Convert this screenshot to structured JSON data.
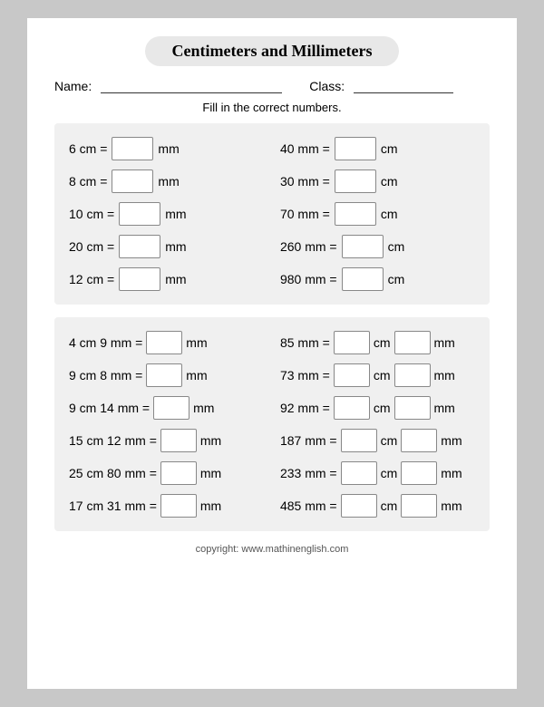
{
  "title": "Centimeters and Millimeters",
  "fields": {
    "name_label": "Name:",
    "class_label": "Class:"
  },
  "instruction": "Fill in the correct numbers.",
  "section1": {
    "left": [
      {
        "problem": "6 cm =",
        "unit": "mm"
      },
      {
        "problem": "8 cm =",
        "unit": "mm"
      },
      {
        "problem": "10 cm =",
        "unit": "mm"
      },
      {
        "problem": "20 cm =",
        "unit": "mm"
      },
      {
        "problem": "12 cm =",
        "unit": "mm"
      }
    ],
    "right": [
      {
        "problem": "40 mm =",
        "unit": "cm"
      },
      {
        "problem": "30 mm =",
        "unit": "cm"
      },
      {
        "problem": "70 mm =",
        "unit": "cm"
      },
      {
        "problem": "260 mm  =",
        "unit": "cm"
      },
      {
        "problem": "980 mm =",
        "unit": "cm"
      }
    ]
  },
  "section2": {
    "left": [
      {
        "problem": "4 cm 9 mm =",
        "unit": "mm"
      },
      {
        "problem": "9 cm 8 mm =",
        "unit": "mm"
      },
      {
        "problem": "9 cm 14 mm =",
        "unit": "mm"
      },
      {
        "problem": "15 cm 12 mm =",
        "unit": "mm"
      },
      {
        "problem": "25 cm 80 mm =",
        "unit": "mm"
      },
      {
        "problem": "17 cm 31 mm =",
        "unit": "mm"
      }
    ],
    "right": [
      {
        "problem": "85 mm =",
        "unit1": "cm",
        "unit2": "mm"
      },
      {
        "problem": "73 mm =",
        "unit1": "cm",
        "unit2": "mm"
      },
      {
        "problem": "92 mm =",
        "unit1": "cm",
        "unit2": "mm"
      },
      {
        "problem": "187 mm =",
        "unit1": "cm",
        "unit2": "mm"
      },
      {
        "problem": "233 mm =",
        "unit1": "cm",
        "unit2": "mm"
      },
      {
        "problem": "485 mm =",
        "unit1": "cm",
        "unit2": "mm"
      }
    ]
  },
  "copyright": "copyright:   www.mathinenglish.com"
}
